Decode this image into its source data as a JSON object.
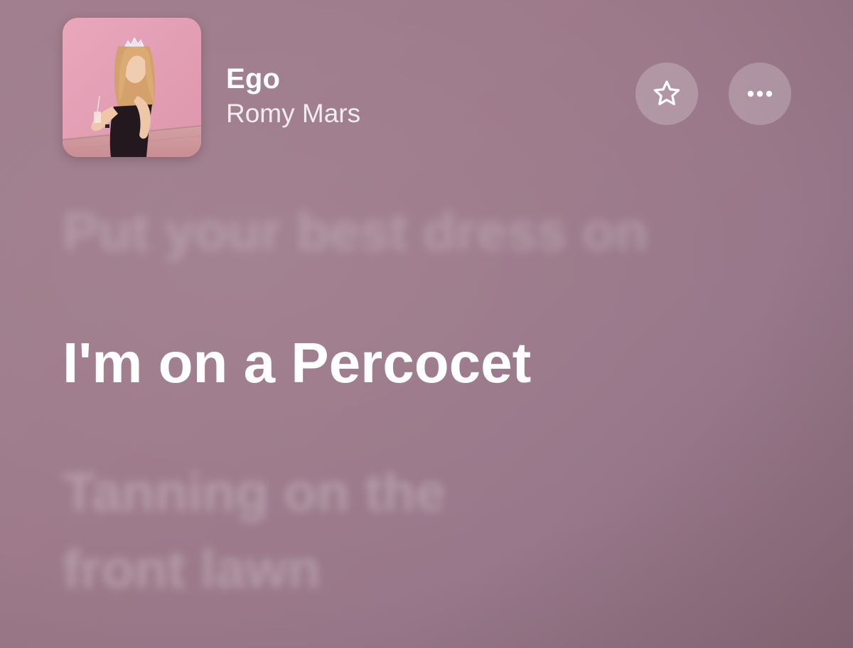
{
  "now_playing": {
    "title": "Ego",
    "artist": "Romy Mars",
    "artwork": "album-cover-girl-with-tiara"
  },
  "actions": {
    "favorite_icon": "star-icon",
    "more_icon": "ellipsis-icon"
  },
  "lyrics": {
    "previous": "Put your best dress on",
    "current": "I'm on a Percocet",
    "next_line_1": "Tanning on the",
    "next_line_2": "front lawn"
  },
  "colors": {
    "background": "#9d7a8a",
    "button_bg": "rgba(255,255,255,0.22)",
    "text": "#ffffff"
  }
}
